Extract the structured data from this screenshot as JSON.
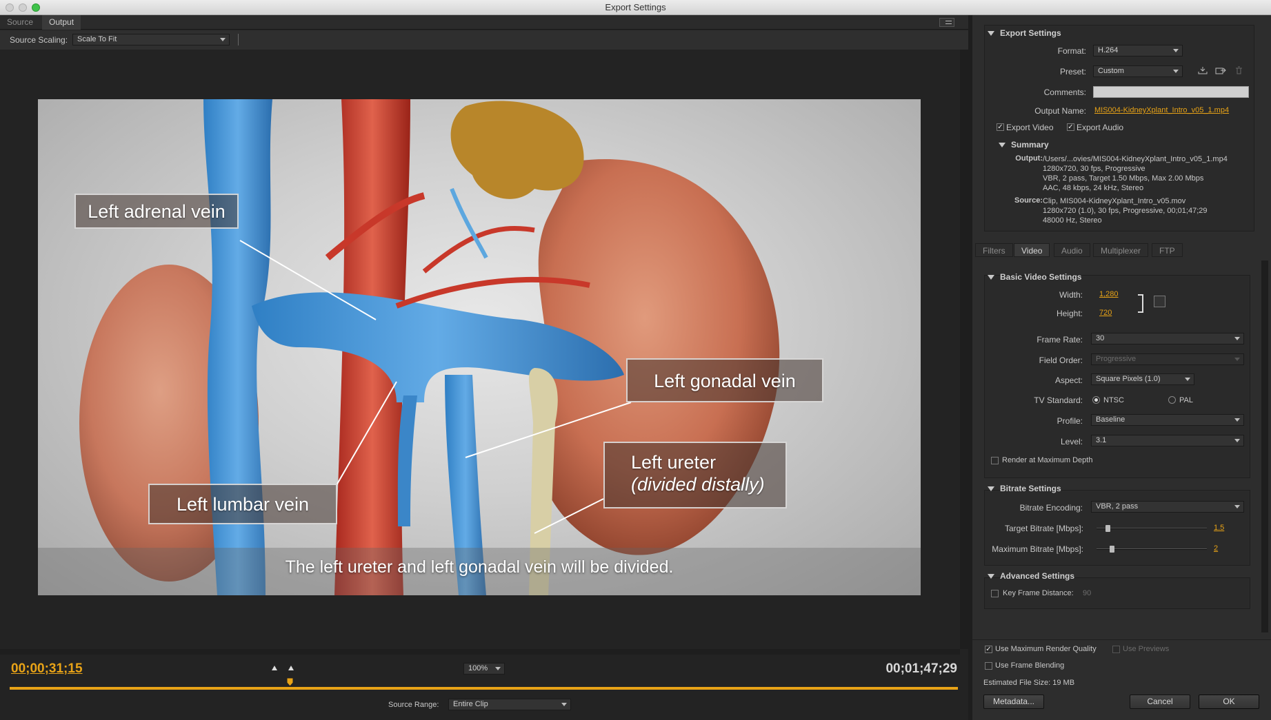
{
  "window": {
    "title": "Export Settings"
  },
  "left": {
    "tabs": [
      "Source",
      "Output"
    ],
    "source_scaling_label": "Source Scaling:",
    "source_scaling_value": "Scale To Fit",
    "callouts": {
      "adrenal": "Left adrenal vein",
      "gonadal": "Left gonadal vein",
      "ureter_line1": "Left ureter",
      "ureter_line2": "(divided distally)",
      "lumbar": "Left lumbar vein"
    },
    "caption": "The left ureter and left gonadal vein will be divided.",
    "current_time": "00;00;31;15",
    "zoom": "100%",
    "duration": "00;01;47;29",
    "source_range_label": "Source Range:",
    "source_range_value": "Entire Clip",
    "playhead_fraction": 0.295
  },
  "export_settings": {
    "header": "Export Settings",
    "format_label": "Format:",
    "format_value": "H.264",
    "preset_label": "Preset:",
    "preset_value": "Custom",
    "comments_label": "Comments:",
    "comments_value": "",
    "output_name_label": "Output Name:",
    "output_name_value": "MIS004-KidneyXplant_Intro_v05_1.mp4",
    "export_video_label": "Export Video",
    "export_video_checked": true,
    "export_audio_label": "Export Audio",
    "export_audio_checked": true,
    "summary_header": "Summary",
    "output_label": "Output:",
    "output_lines": [
      "/Users/...ovies/MIS004-KidneyXplant_Intro_v05_1.mp4",
      "1280x720, 30 fps, Progressive",
      "VBR, 2 pass, Target 1.50 Mbps, Max 2.00 Mbps",
      "AAC, 48 kbps, 24 kHz, Stereo"
    ],
    "source_label": "Source:",
    "source_lines": [
      "Clip, MIS004-KidneyXplant_Intro_v05.mov",
      "1280x720 (1.0), 30 fps, Progressive, 00;01;47;29",
      "48000 Hz, Stereo"
    ]
  },
  "right_tabs": [
    "Filters",
    "Video",
    "Audio",
    "Multiplexer",
    "FTP"
  ],
  "basic_video": {
    "header": "Basic Video Settings",
    "width_label": "Width:",
    "width_value": "1,280",
    "height_label": "Height:",
    "height_value": "720",
    "frame_rate_label": "Frame Rate:",
    "frame_rate_value": "30",
    "field_order_label": "Field Order:",
    "field_order_value": "Progressive",
    "aspect_label": "Aspect:",
    "aspect_value": "Square Pixels (1.0)",
    "tv_standard_label": "TV Standard:",
    "tv_ntsc": "NTSC",
    "tv_pal": "PAL",
    "profile_label": "Profile:",
    "profile_value": "Baseline",
    "level_label": "Level:",
    "level_value": "3.1",
    "render_max_depth_label": "Render at Maximum Depth"
  },
  "bitrate": {
    "header": "Bitrate Settings",
    "encoding_label": "Bitrate Encoding:",
    "encoding_value": "VBR, 2 pass",
    "target_label": "Target Bitrate [Mbps]:",
    "target_value": "1.5",
    "target_fraction": 0.08,
    "max_label": "Maximum Bitrate [Mbps]:",
    "max_value": "2",
    "max_fraction": 0.12
  },
  "advanced": {
    "header": "Advanced Settings",
    "key_frame_label": "Key Frame Distance:",
    "key_frame_value": "90"
  },
  "bottom": {
    "max_render_quality_label": "Use Maximum Render Quality",
    "use_previews_label": "Use Previews",
    "frame_blending_label": "Use Frame Blending",
    "estimated_size_label": "Estimated File Size:",
    "estimated_size_value": "19 MB",
    "metadata_button": "Metadata...",
    "cancel_button": "Cancel",
    "ok_button": "OK"
  },
  "colors": {
    "accent": "#e8a317",
    "panel": "#2d2d2d",
    "background": "#232323"
  }
}
